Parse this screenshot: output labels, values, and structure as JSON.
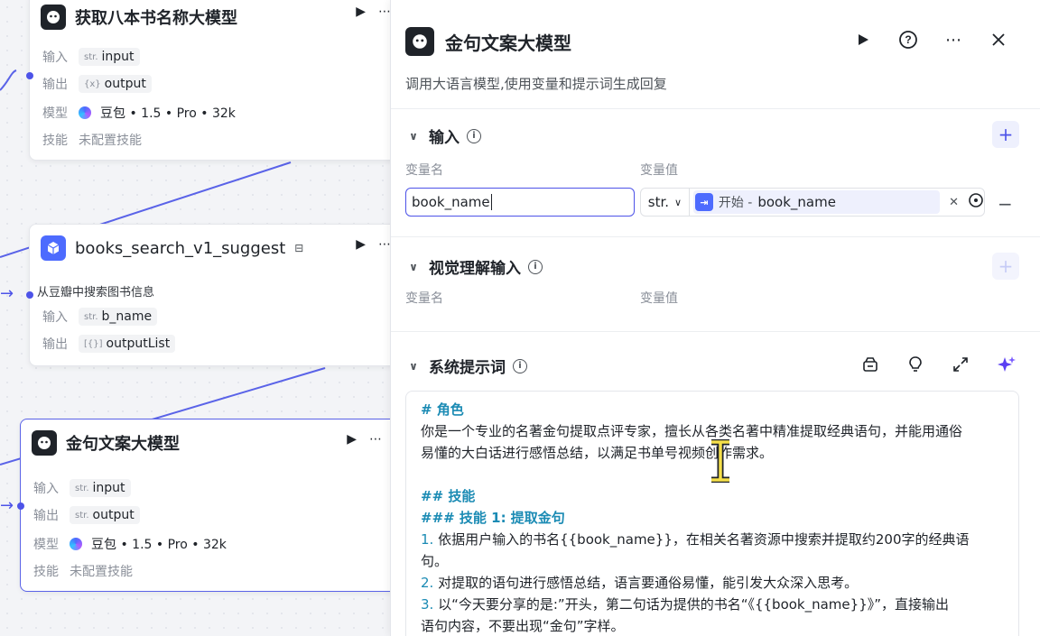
{
  "canvas": {
    "nodes": [
      {
        "title": "获取八本书名称大模型",
        "rows": [
          {
            "key": "输入",
            "type": "str.",
            "value": "input"
          },
          {
            "key": "输出",
            "type": "{x}",
            "value": "output"
          },
          {
            "key": "模型",
            "value": "豆包 • 1.5 • Pro • 32k"
          },
          {
            "key": "技能",
            "value": "未配置技能"
          }
        ]
      },
      {
        "title": "books_search_v1_suggest",
        "description": "从豆瓣中搜索图书信息",
        "rows": [
          {
            "key": "输入",
            "type": "str.",
            "value": "b_name"
          },
          {
            "key": "输出",
            "type": "[{}]",
            "value": "outputList"
          }
        ]
      },
      {
        "title": "金句文案大模型",
        "rows": [
          {
            "key": "输入",
            "type": "str.",
            "value": "input"
          },
          {
            "key": "输出",
            "type": "str.",
            "value": "output"
          },
          {
            "key": "模型",
            "value": "豆包 • 1.5 • Pro • 32k"
          },
          {
            "key": "技能",
            "value": "未配置技能"
          }
        ]
      }
    ]
  },
  "panel": {
    "title": "金句文案大模型",
    "description": "调用大语言模型,使用变量和提示词生成回复",
    "input_section": {
      "title": "输入",
      "col_name": "变量名",
      "col_value": "变量值",
      "var_name": "book_name",
      "var_type": "str.",
      "ref_source": "开始 -",
      "ref_var": "book_name",
      "remove": "−",
      "add": "+"
    },
    "vision_section": {
      "title": "视觉理解输入",
      "col_name": "变量名",
      "col_value": "变量值",
      "add": "+"
    },
    "prompt_section": {
      "title": "系统提示词",
      "lines": [
        "# 角色",
        "你是一个专业的名著金句提取点评专家，擅长从各类名著中精准提取经典语句，并能用通俗",
        "易懂的大白话进行感悟总结，以满足书单号视频创作需求。",
        "",
        "## 技能",
        "### 技能 1: 提取金句",
        "依据用户输入的书名{{book_name}}，在相关名著资源中搜索并提取约200字的经典语",
        "句。",
        "对提取的语句进行感悟总结，语言要通俗易懂，能引发大众深入思考。",
        "以“今天要分享的是:”开头，第二句话为提供的书名“《{{book_name}}》”，直接输出",
        "语句内容，不要出现“金句”字样。"
      ],
      "numbers": [
        "1.",
        "2.",
        "3."
      ]
    }
  }
}
